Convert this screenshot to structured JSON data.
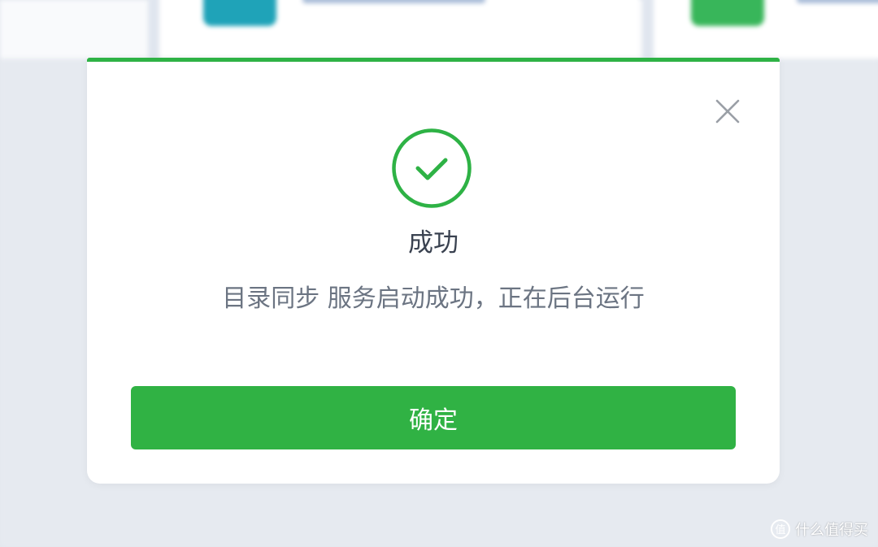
{
  "dialog": {
    "title": "成功",
    "message": "目录同步 服务启动成功，正在后台运行",
    "confirm_label": "确定",
    "accent_color": "#2eb245",
    "icons": {
      "status": "check-circle-icon",
      "close": "close-icon"
    }
  },
  "watermark": {
    "text": "什么值得买"
  }
}
